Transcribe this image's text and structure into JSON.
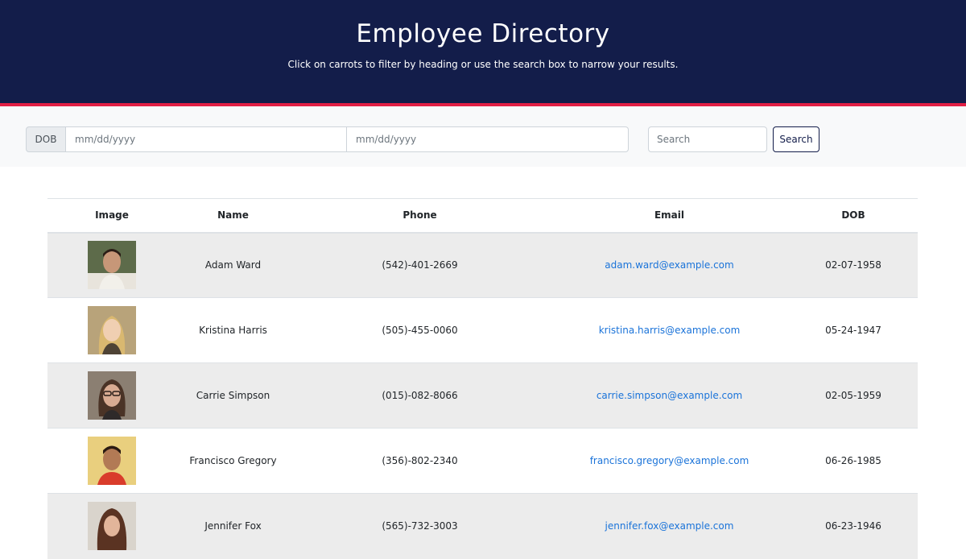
{
  "header": {
    "title": "Employee Directory",
    "subtitle": "Click on carrots to filter by heading or use the search box to narrow your results."
  },
  "filters": {
    "dob_label": "DOB",
    "start_date_placeholder": "mm/dd/yyyy",
    "end_date_placeholder": "mm/dd/yyyy",
    "search_placeholder": "Search",
    "search_button_label": "Search"
  },
  "table": {
    "columns": [
      "Image",
      "Name",
      "Phone",
      "Email",
      "DOB"
    ],
    "rows": [
      {
        "name": "Adam Ward",
        "phone": "(542)-401-2669",
        "email": "adam.ward@example.com",
        "dob": "02-07-1958",
        "avatar": "avatar-photo"
      },
      {
        "name": "Kristina Harris",
        "phone": "(505)-455-0060",
        "email": "kristina.harris@example.com",
        "dob": "05-24-1947",
        "avatar": "avatar-photo"
      },
      {
        "name": "Carrie Simpson",
        "phone": "(015)-082-8066",
        "email": "carrie.simpson@example.com",
        "dob": "02-05-1959",
        "avatar": "avatar-photo"
      },
      {
        "name": "Francisco Gregory",
        "phone": "(356)-802-2340",
        "email": "francisco.gregory@example.com",
        "dob": "06-26-1985",
        "avatar": "avatar-photo"
      },
      {
        "name": "Jennifer Fox",
        "phone": "(565)-732-3003",
        "email": "jennifer.fox@example.com",
        "dob": "06-23-1946",
        "avatar": "avatar-photo"
      }
    ]
  },
  "colors": {
    "header_bg": "#131d4a",
    "accent_stripe": "#e21f45",
    "link": "#1a73d9",
    "row_shade": "#ececec"
  }
}
